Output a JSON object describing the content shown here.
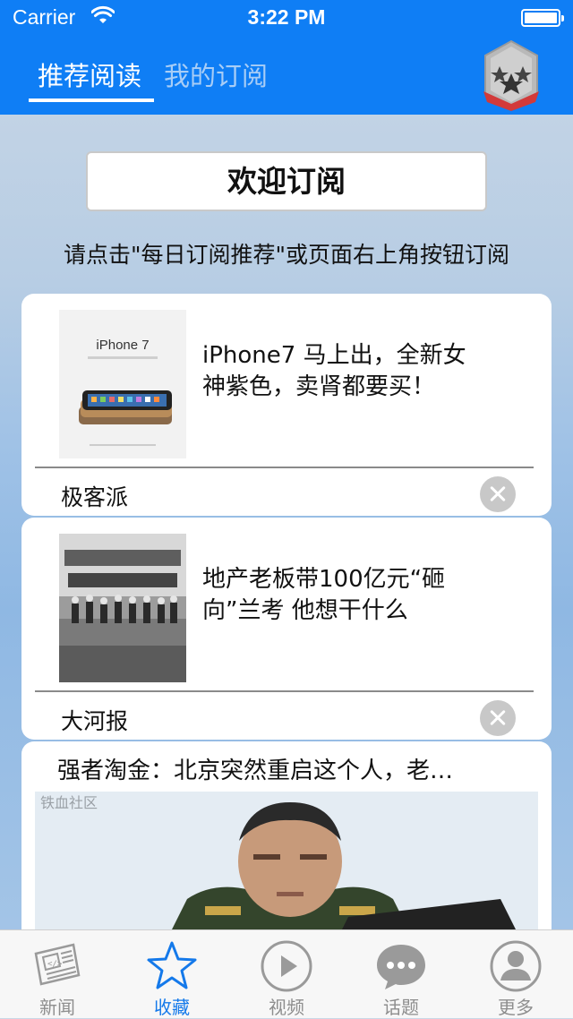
{
  "status_bar": {
    "carrier": "Carrier",
    "time": "3:22 PM"
  },
  "nav": {
    "tabs": [
      {
        "label": "推荐阅读",
        "active": true
      },
      {
        "label": "我的订阅",
        "active": false
      }
    ]
  },
  "welcome": {
    "button_label": "欢迎订阅",
    "hint": "请点击\"每日订阅推荐\"或页面右上角按钮订阅"
  },
  "feed": [
    {
      "title": "iPhone7 马上出，全新女神紫色，卖肾都要买！",
      "source": "极客派",
      "thumb_text": "iPhone 7"
    },
    {
      "title": "地产老板带100亿元“砸向”兰考 他想干什么",
      "source": "大河报"
    },
    {
      "title": "强者淘金：北京突然重启这个人，老…",
      "watermark": "铁血社区"
    }
  ],
  "tabbar": {
    "items": [
      {
        "label": "新闻",
        "icon": "newspaper-icon",
        "active": false
      },
      {
        "label": "收藏",
        "icon": "star-icon",
        "active": true
      },
      {
        "label": "视频",
        "icon": "play-icon",
        "active": false
      },
      {
        "label": "话题",
        "icon": "chat-bubble-icon",
        "active": false
      },
      {
        "label": "更多",
        "icon": "user-icon",
        "active": false
      }
    ]
  },
  "colors": {
    "accent": "#0f7ef5",
    "tab_active": "#1479ea",
    "tab_inactive": "#8e8e8e"
  }
}
